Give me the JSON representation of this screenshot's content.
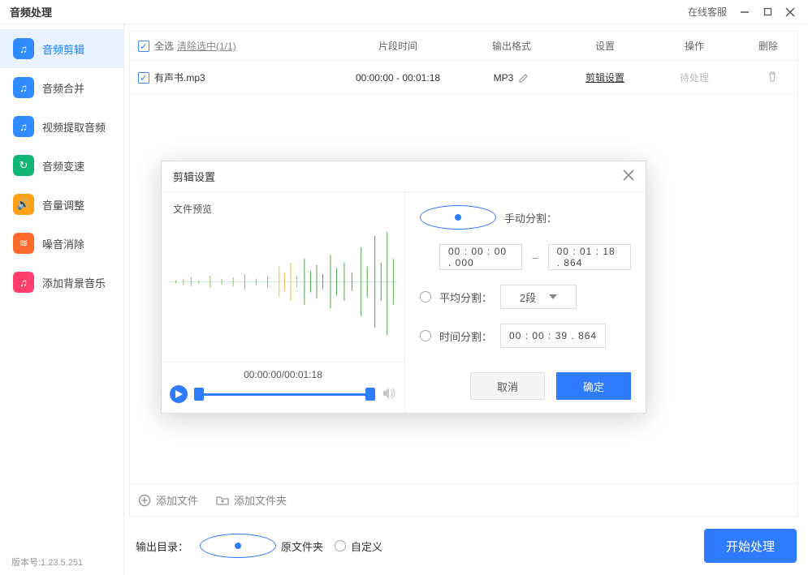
{
  "titlebar": {
    "app_name": "音频处理",
    "help": "在线客服"
  },
  "sidebar": {
    "items": [
      {
        "label": "音频剪辑"
      },
      {
        "label": "音频合并"
      },
      {
        "label": "视频提取音频"
      },
      {
        "label": "音频变速"
      },
      {
        "label": "音量调整"
      },
      {
        "label": "噪音消除"
      },
      {
        "label": "添加背景音乐"
      }
    ]
  },
  "header": {
    "select_all": "全选",
    "clear": "清除选中(1/1)",
    "col_time": "片段时间",
    "col_fmt": "输出格式",
    "col_set": "设置",
    "col_op": "操作",
    "col_del": "删除"
  },
  "row": {
    "name": "有声书.mp3",
    "time": "00:00:00 - 00:01:18",
    "fmt": "MP3",
    "set": "剪辑设置",
    "op": "待处理"
  },
  "addbar": {
    "file": "添加文件",
    "folder": "添加文件夹"
  },
  "footer": {
    "out_label": "输出目录：",
    "orig": "原文件夹",
    "custom": "自定义",
    "start": "开始处理"
  },
  "version": "版本号:1.23.5.251",
  "modal": {
    "title": "剪辑设置",
    "preview_label": "文件预览",
    "play_time": "00:00:00/00:01:18",
    "opt_manual": "手动分割：",
    "manual_from": "00 : 00 : 00 . 000",
    "manual_to": "00 : 01 : 18 . 864",
    "opt_avg": "平均分割：",
    "avg_val": "2段",
    "opt_time": "时间分割：",
    "time_val": "00 : 00 : 39 . 864",
    "cancel": "取消",
    "ok": "确定"
  }
}
